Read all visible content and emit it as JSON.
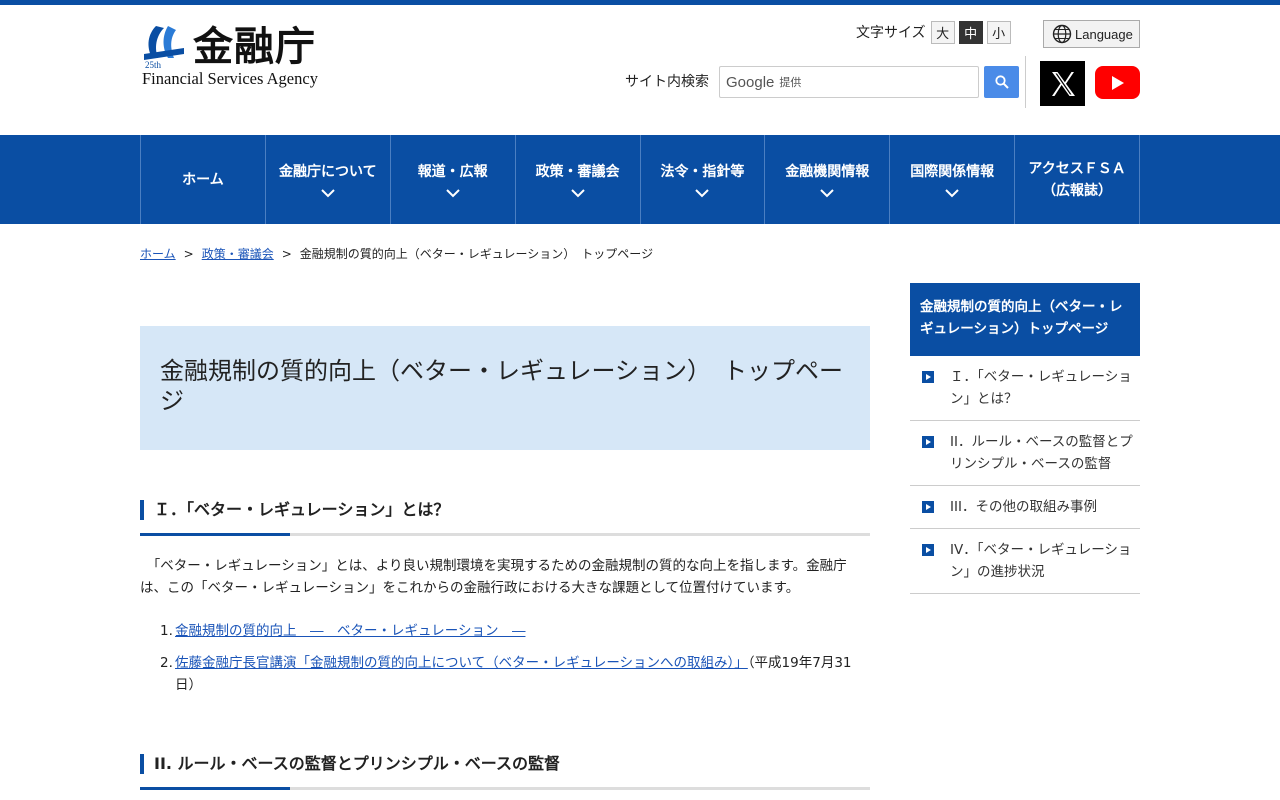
{
  "header": {
    "logo_kanji": "金融庁",
    "logo_english": "Financial Services Agency",
    "logo_badge": "25th",
    "font_size_label": "文字サイズ",
    "font_sizes": [
      "大",
      "中",
      "小"
    ],
    "font_size_selected": "中",
    "language_label": "Language",
    "search_label": "サイト内検索",
    "search_placeholder_brand": "Google",
    "search_placeholder_suffix": "提供"
  },
  "nav": {
    "items": [
      {
        "label": "ホーム",
        "has_dropdown": false
      },
      {
        "label": "金融庁について",
        "has_dropdown": true
      },
      {
        "label": "報道・広報",
        "has_dropdown": true
      },
      {
        "label": "政策・審議会",
        "has_dropdown": true
      },
      {
        "label": "法令・指針等",
        "has_dropdown": true
      },
      {
        "label": "金融機関情報",
        "has_dropdown": true
      },
      {
        "label": "国際関係情報",
        "has_dropdown": true
      },
      {
        "label": "アクセスＦＳＡ",
        "label2": "（広報誌）",
        "has_dropdown": false
      }
    ]
  },
  "breadcrumb": {
    "items": [
      "ホーム",
      "政策・審議会",
      "金融規制の質的向上（ベター・レギュレーション）　トップページ"
    ],
    "separator": ">"
  },
  "main": {
    "title": "金融規制の質的向上（ベター・レギュレーション）　トップページ",
    "section1_heading": "Ｉ．「ベター・レギュレーション」とは？",
    "section1_paragraph": "「ベター・レギュレーション」とは、より良い規制環境を実現するための金融規制の質的な向上を指します。金融庁は、この「ベター・レギュレーション」をこれからの金融行政における大きな課題として位置付けています。",
    "section1_links": [
      {
        "num": "1.",
        "text": "金融規制の質的向上　―　ベター・レギュレーション　―",
        "suffix": ""
      },
      {
        "num": "2.",
        "text": "佐藤金融庁長官講演「金融規制の質的向上について（ベター・レギュレーションへの取組み）」",
        "suffix": "（平成19年7月31日）"
      }
    ],
    "section2_heading": "II. ルール・ベースの監督とプリンシプル・ベースの監督"
  },
  "sidebar": {
    "heading": "金融規制の質的向上（ベター・レギュレーション）トップページ",
    "items": [
      "Ｉ．「ベター・レギュレーション」とは？",
      "II．ルール・ベースの監督とプリンシプル・ベースの監督",
      "III．その他の取組み事例",
      "IV．「ベター・レギュレーション」の進捗状況"
    ]
  },
  "colors": {
    "brand": "#0a4ea3",
    "title_bg": "#d6e7f7",
    "link": "#1a54b8",
    "youtube": "#ff0000",
    "search_button": "#4a8be8"
  }
}
